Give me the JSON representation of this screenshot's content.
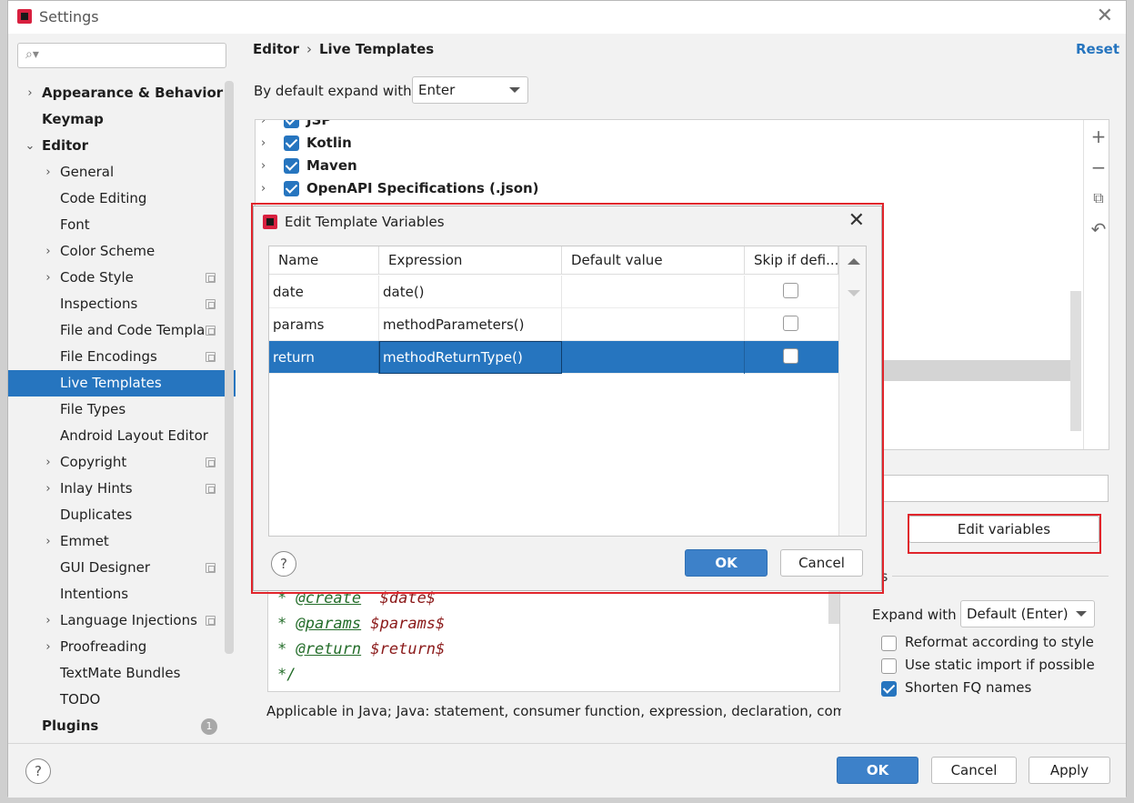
{
  "window": {
    "title": "Settings",
    "close_glyph": "✕"
  },
  "search": {
    "icon": "search-icon",
    "value": ""
  },
  "sidebar": {
    "items": [
      {
        "label": "Appearance & Behavior",
        "bold": true,
        "chevron": "›"
      },
      {
        "label": "Keymap",
        "bold": true
      },
      {
        "label": "Editor",
        "bold": true,
        "chevron": "⌄"
      },
      {
        "label": "General",
        "chevron": "›"
      },
      {
        "label": "Code Editing"
      },
      {
        "label": "Font"
      },
      {
        "label": "Color Scheme",
        "chevron": "›"
      },
      {
        "label": "Code Style",
        "chevron": "›",
        "cfg": true
      },
      {
        "label": "Inspections",
        "cfg": true
      },
      {
        "label": "File and Code Templa",
        "cfg": true
      },
      {
        "label": "File Encodings",
        "cfg": true
      },
      {
        "label": "Live Templates",
        "selected": true
      },
      {
        "label": "File Types"
      },
      {
        "label": "Android Layout Editor"
      },
      {
        "label": "Copyright",
        "chevron": "›",
        "cfg": true
      },
      {
        "label": "Inlay Hints",
        "chevron": "›",
        "cfg": true
      },
      {
        "label": "Duplicates"
      },
      {
        "label": "Emmet",
        "chevron": "›"
      },
      {
        "label": "GUI Designer",
        "cfg": true
      },
      {
        "label": "Intentions"
      },
      {
        "label": "Language Injections",
        "chevron": "›",
        "cfg": true
      },
      {
        "label": "Proofreading",
        "chevron": "›"
      },
      {
        "label": "TextMate Bundles"
      },
      {
        "label": "TODO"
      },
      {
        "label": "Plugins",
        "bold": true,
        "badge": "1"
      }
    ]
  },
  "header": {
    "crumb_1": "Editor",
    "crumb_sep": "›",
    "crumb_2": "Live Templates",
    "reset": "Reset"
  },
  "expand_default": {
    "label": "By default expand with",
    "value": "Enter"
  },
  "tree": {
    "rows": [
      {
        "label": "JSP",
        "checked": true
      },
      {
        "label": "Kotlin",
        "checked": true
      },
      {
        "label": "Maven",
        "checked": true
      },
      {
        "label": "OpenAPI Specifications (.json)",
        "checked": true
      }
    ],
    "tools": {
      "add": "+",
      "remove": "−",
      "copy": "⧉",
      "restore": "↶"
    }
  },
  "edit_variables_button": "Edit variables",
  "options": {
    "label": "ns",
    "expand_with_label": "Expand with",
    "expand_with_value": "Default (Enter)",
    "reformat": {
      "label": "Reformat according to style",
      "checked": false
    },
    "static_import": {
      "label": "Use static import if possible",
      "checked": false
    },
    "shorten_fq": {
      "label": "Shorten FQ names",
      "checked": true
    }
  },
  "template_text": {
    "lines": [
      {
        "star": "* ",
        "tag": "@create",
        "gap": "  ",
        "var": "$date$"
      },
      {
        "star": "* ",
        "tag": "@params",
        "gap": " ",
        "var": "$params$"
      },
      {
        "star": "* ",
        "tag": "@return",
        "gap": " ",
        "var": "$return$"
      },
      {
        "star": "*/",
        "tag": "",
        "gap": "",
        "var": ""
      }
    ]
  },
  "applicable": "Applicable in Java; Java: statement, consumer function, expression, declaration, comme",
  "footer": {
    "help": "?",
    "ok": "OK",
    "cancel": "Cancel",
    "apply": "Apply"
  },
  "dialog": {
    "title": "Edit Template Variables",
    "close_glyph": "✕",
    "columns": [
      "Name",
      "Expression",
      "Default value",
      "Skip if defi..."
    ],
    "rows": [
      {
        "name": "date",
        "expression": "date()",
        "default": "",
        "skip": false
      },
      {
        "name": "params",
        "expression": "methodParameters()",
        "default": "",
        "skip": false
      },
      {
        "name": "return",
        "expression": "methodReturnType()",
        "default": "",
        "skip": false,
        "selected": true
      }
    ],
    "help": "?",
    "ok": "OK",
    "cancel": "Cancel"
  },
  "colors": {
    "accent": "#2675bf",
    "highlight_outline": "#e0242b",
    "code_comment": "#246d2a",
    "code_var": "#8b1a1a"
  }
}
